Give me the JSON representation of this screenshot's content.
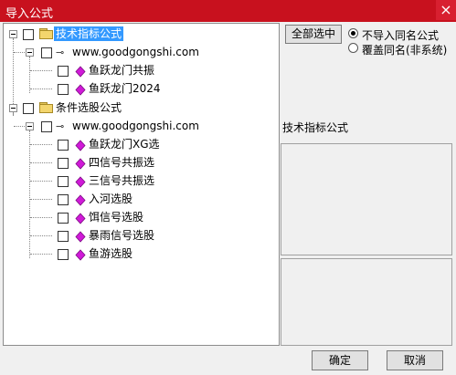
{
  "window": {
    "title": "导入公式",
    "close_glyph": "×"
  },
  "tree": {
    "nodes": [
      {
        "label": "技术指标公式",
        "kind": "folder",
        "selected": true
      },
      {
        "label": "www.goodgongshi.com",
        "kind": "site"
      },
      {
        "label": "鱼跃龙门共振",
        "kind": "formula"
      },
      {
        "label": "鱼跃龙门2024",
        "kind": "formula"
      },
      {
        "label": "条件选股公式",
        "kind": "folder"
      },
      {
        "label": "www.goodgongshi.com",
        "kind": "site"
      },
      {
        "label": "鱼跃龙门XG选",
        "kind": "formula"
      },
      {
        "label": "四信号共振选",
        "kind": "formula"
      },
      {
        "label": "三信号共振选",
        "kind": "formula"
      },
      {
        "label": "入河选股",
        "kind": "formula"
      },
      {
        "label": "饵信号选股",
        "kind": "formula"
      },
      {
        "label": "暴雨信号选股",
        "kind": "formula"
      },
      {
        "label": "鱼游选股",
        "kind": "formula"
      }
    ]
  },
  "options": {
    "select_all_label": "全部选中",
    "radio_no_import": "不导入同名公式",
    "radio_overwrite": "覆盖同名(非系统)",
    "selected_option": "不导入同名公式"
  },
  "info": {
    "section_label": "技术指标公式"
  },
  "buttons": {
    "ok_label": "确定",
    "cancel_label": "取消"
  },
  "colors": {
    "titlebar": "#c8111e",
    "selection": "#3399ff",
    "gem": "#d01ad8"
  }
}
